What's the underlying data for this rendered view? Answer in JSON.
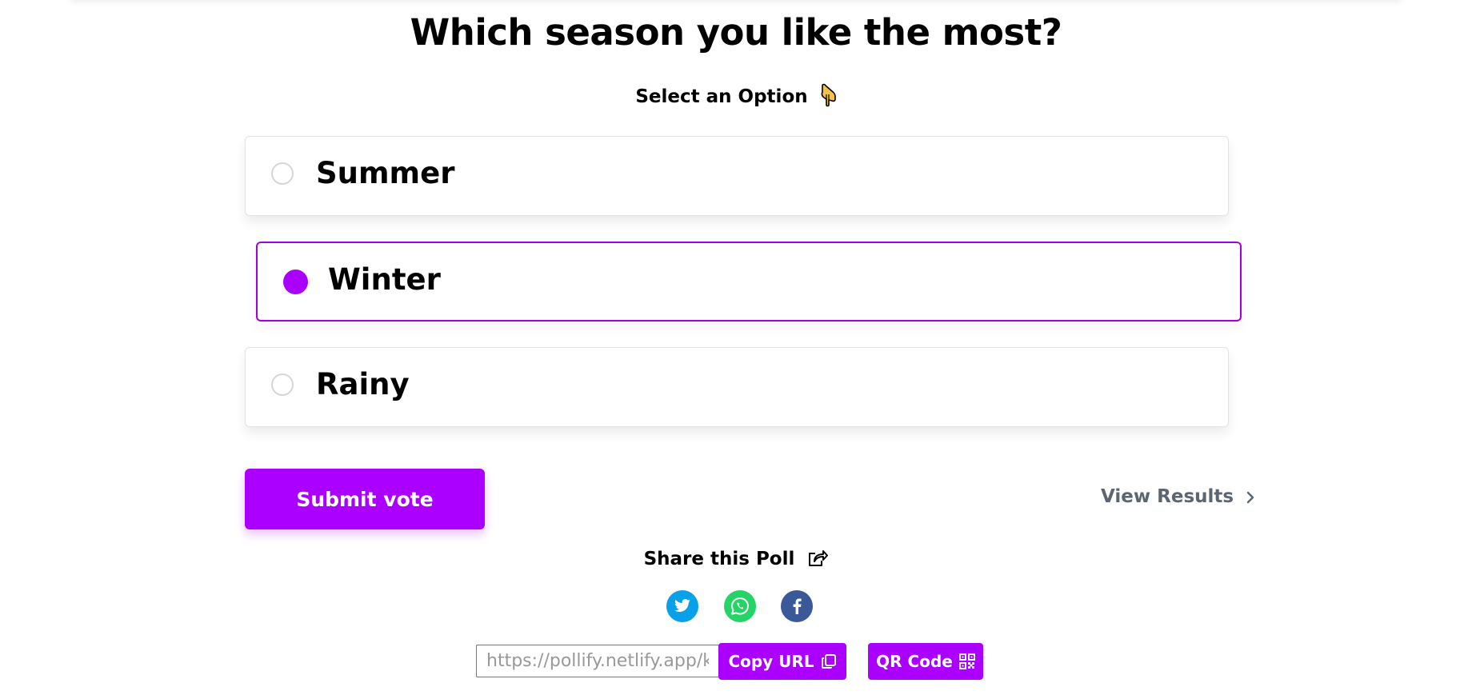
{
  "poll": {
    "question": "Which season you like the most?",
    "instruction": "Select an Option",
    "options": [
      {
        "label": "Summer",
        "selected": false
      },
      {
        "label": "Winter",
        "selected": true
      },
      {
        "label": "Rainy",
        "selected": false
      }
    ]
  },
  "actions": {
    "submit_label": "Submit vote",
    "view_results_label": "View Results"
  },
  "share": {
    "title": "Share this Poll",
    "networks": [
      "twitter-icon",
      "whatsapp-icon",
      "facebook-icon"
    ],
    "url_value": "https://pollify.netlify.app/k",
    "copy_label": "Copy URL",
    "qr_label": "QR Code"
  },
  "colors": {
    "accent": "#ab00ff",
    "twitter": "#08a0e9",
    "whatsapp": "#25d366",
    "facebook": "#3b5998",
    "muted_text": "#5c6670"
  }
}
